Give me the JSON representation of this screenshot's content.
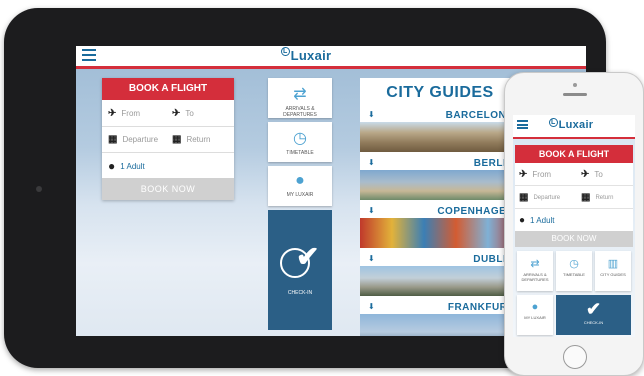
{
  "tablet": {
    "logo": "Luxair",
    "logo_mark": "L",
    "book": {
      "title": "BOOK A FLIGHT",
      "from_placeholder": "From",
      "to_placeholder": "To",
      "departure_label": "Departure",
      "return_label": "Return",
      "passengers": "1 Adult",
      "book_now": "BOOK NOW"
    },
    "tiles": {
      "arrivals": "ARRIVALS & DEPARTURES",
      "timetable": "TIMETABLE",
      "my_luxair": "MY LUXAIR",
      "checkin": "CHECK-IN"
    },
    "city_guides": {
      "title": "CITY GUIDES",
      "cities": [
        "BARCELONA",
        "BERLIN",
        "COPENHAGEN",
        "DUBLIN",
        "FRANKFURT"
      ]
    }
  },
  "phone": {
    "logo": "Luxair",
    "logo_mark": "L",
    "book": {
      "title": "BOOK A FLIGHT",
      "from_placeholder": "From",
      "to_placeholder": "To",
      "departure_label": "Departure",
      "return_label": "Return",
      "passengers": "1 Adult",
      "book_now": "BOOK NOW"
    },
    "tiles": {
      "arrivals": "ARRIVALS & DEPARTURES",
      "timetable": "TIMETABLE",
      "city_guides": "CITY GUIDES",
      "my_luxair": "MY LUXAIR",
      "checkin": "CHECK-IN"
    }
  },
  "colors": {
    "brand_red": "#d42e3b",
    "brand_blue": "#1a6b9c",
    "checkin_blue": "#2b5f86",
    "icon_blue": "#4da2d1"
  },
  "icons": [
    "menu-icon",
    "plane-takeoff-icon",
    "plane-landing-icon",
    "calendar-icon",
    "person-icon",
    "swap-arrows-icon",
    "clock-icon",
    "user-icon",
    "checkmark-plane-icon",
    "download-icon",
    "map-icon"
  ]
}
